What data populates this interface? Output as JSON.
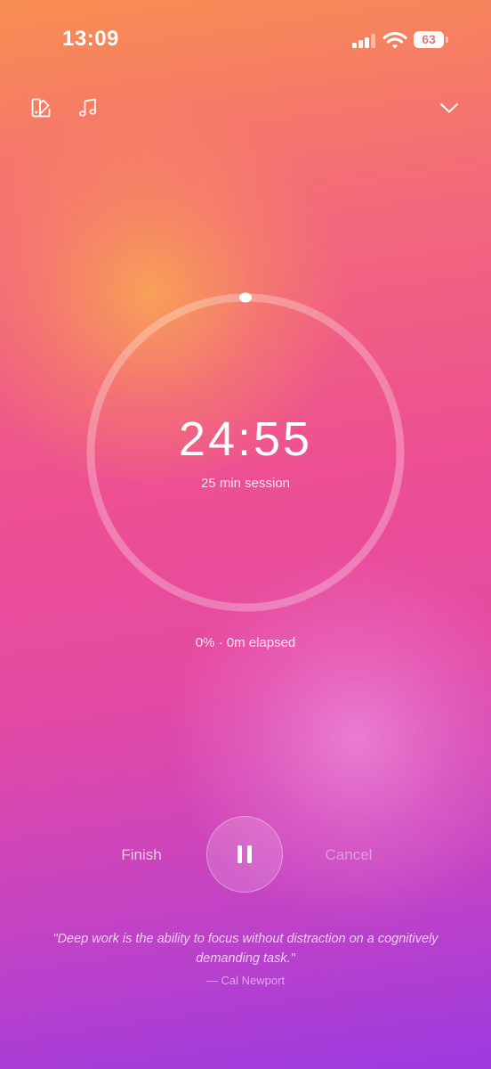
{
  "status_bar": {
    "time": "13:09",
    "battery_level": "63",
    "signal_icon": "cellular-signal-icon",
    "wifi_icon": "wifi-icon",
    "battery_icon": "battery-icon"
  },
  "toolbar": {
    "theme_icon": "theme-palette-icon",
    "music_icon": "music-note-icon",
    "collapse_icon": "chevron-down-icon"
  },
  "timer": {
    "time_remaining": "24:55",
    "session_label": "25 min session",
    "progress_text": "0% · 0m elapsed",
    "progress_fraction": 0
  },
  "controls": {
    "finish_label": "Finish",
    "pause_icon": "pause-icon",
    "cancel_label": "Cancel"
  },
  "quote": {
    "text": "\"Deep work is the ability to focus without distraction on a cognitively demanding task.\"",
    "author": "— Cal Newport"
  },
  "colors": {
    "gradient_top": "#f88e50",
    "gradient_middle": "#ed4f92",
    "gradient_bottom": "#9c3ae0",
    "text": "#ffffff"
  }
}
